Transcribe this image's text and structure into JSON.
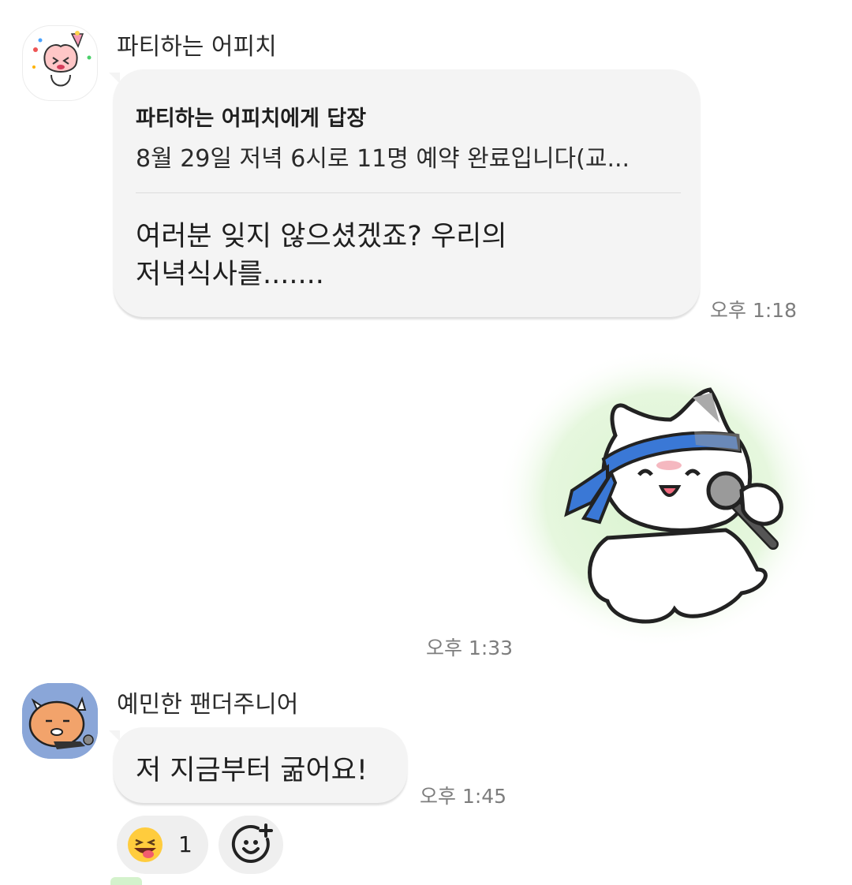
{
  "chat": {
    "msg1": {
      "sender": "파티하는 어피치",
      "reply_title": "파티하는 어피치에게 답장",
      "reply_quote": "8월 29일 저녁 6시로 11명 예약 완료입니다(교...",
      "message_lines": [
        "여러분 잊지 않으셨겠죠? 우리의",
        "저녁식사를......."
      ],
      "time": "오후 1:18",
      "avatar_icon": "apeach-party-avatar-icon"
    },
    "msg2": {
      "sticker_icon": "cat-singing-microphone-sticker-icon",
      "time": "오후 1:33"
    },
    "msg3": {
      "sender": "예민한 팬더주니어",
      "text": "저 지금부터 굶어요!",
      "time": "오후 1:45",
      "avatar_icon": "panda-junior-avatar-icon",
      "reaction": {
        "emoji": "grinning-tongue-emoji-icon",
        "count": "1"
      },
      "add_reaction_icon": "add-emoji-reaction-icon"
    }
  },
  "colors": {
    "bubble": "#f4f4f4",
    "time_text": "#7d7d7d",
    "panda_avatar_bg": "#8aa6d8",
    "sticker_glow": "#d9f3cf",
    "headband": "#3a78d6"
  }
}
